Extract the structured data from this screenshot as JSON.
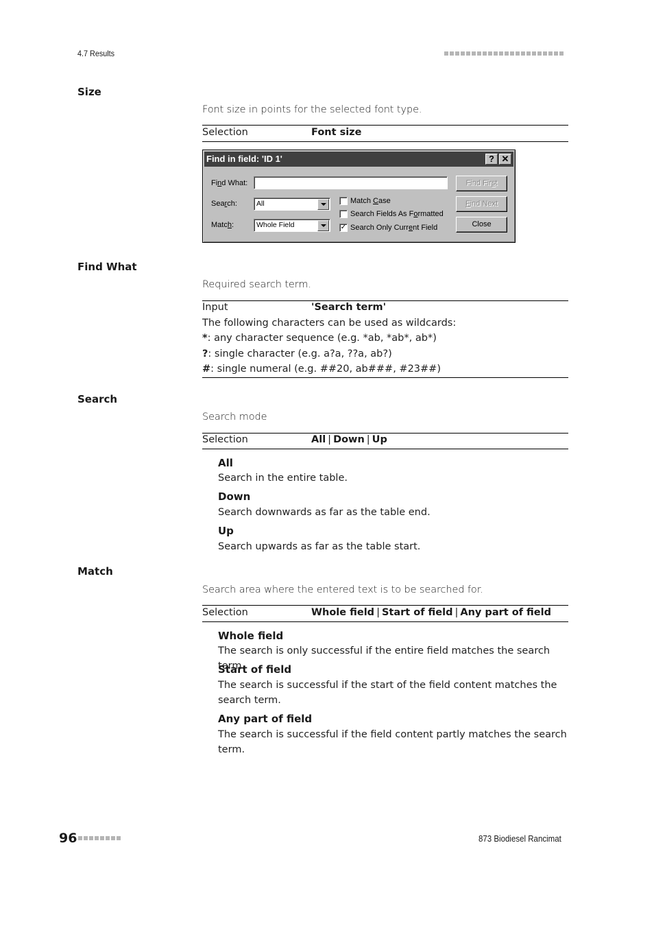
{
  "header": {
    "section": "4.7 Results",
    "square_count": 22
  },
  "footer": {
    "page_number": "96",
    "square_count": 8,
    "product": "873 Biodiesel Rancimat"
  },
  "sections": {
    "size": {
      "title": "Size",
      "description": "Font size in points for the selected font type.",
      "row_label": "Selection",
      "row_value": "Font size"
    },
    "find_what": {
      "title": "Find What",
      "description": "Required search term.",
      "row_label": "Input",
      "row_value": "'Search term'",
      "wildcard_intro": "The following characters can be used as wildcards:",
      "wildcards": [
        {
          "symbol": "*",
          "text": ": any character sequence (e.g. *ab, *ab*, ab*)"
        },
        {
          "symbol": "?",
          "text": ": single character (e.g. a?a, ??a, ab?)"
        },
        {
          "symbol": "#",
          "text": ": single numeral (e.g. ##20, ab###, #23##)"
        }
      ]
    },
    "search": {
      "title": "Search",
      "description": "Search mode",
      "row_label": "Selection",
      "values": [
        "All",
        "Down",
        "Up"
      ],
      "options": [
        {
          "title": "All",
          "desc": "Search in the entire table."
        },
        {
          "title": "Down",
          "desc": "Search downwards as far as the table end."
        },
        {
          "title": "Up",
          "desc": "Search upwards as far as the table start."
        }
      ]
    },
    "match": {
      "title": "Match",
      "description": "Search area where the entered text is to be searched for.",
      "row_label": "Selection",
      "values": [
        "Whole field",
        "Start of field",
        "Any part of field"
      ],
      "options": [
        {
          "title": "Whole field",
          "desc": "The search is only successful if the entire field matches the search term."
        },
        {
          "title": "Start of field",
          "desc": "The search is successful if the start of the field content matches the search term."
        },
        {
          "title": "Any part of field",
          "desc": "The search is successful if the field content partly matches the search term."
        }
      ]
    }
  },
  "dialog": {
    "title": "Find in field: 'ID 1'",
    "help_glyph": "?",
    "close_glyph": "✕",
    "find_what": {
      "label_pre": "Fi",
      "label_ul": "n",
      "label_post": "d What:",
      "value": ""
    },
    "search": {
      "label_pre": "Sea",
      "label_ul": "r",
      "label_post": "ch:",
      "value": "All"
    },
    "match": {
      "label_pre": "Matc",
      "label_ul": "h",
      "label_post": ":",
      "value": "Whole Field"
    },
    "checkboxes": [
      {
        "pre": "Match ",
        "ul": "C",
        "post": "ase",
        "checked": false
      },
      {
        "pre": "Search Fields As F",
        "ul": "o",
        "post": "rmatted",
        "checked": false
      },
      {
        "pre": "Search Only Curr",
        "ul": "e",
        "post": "nt Field",
        "checked": true
      }
    ],
    "buttons": {
      "find_first": {
        "pre": "Find Fir",
        "ul": "s",
        "post": "t",
        "disabled": true
      },
      "find_next": {
        "pre": "",
        "ul": "F",
        "post": "ind Next",
        "disabled": true
      },
      "close": {
        "label": "Close"
      }
    },
    "check_glyph": "✓"
  }
}
